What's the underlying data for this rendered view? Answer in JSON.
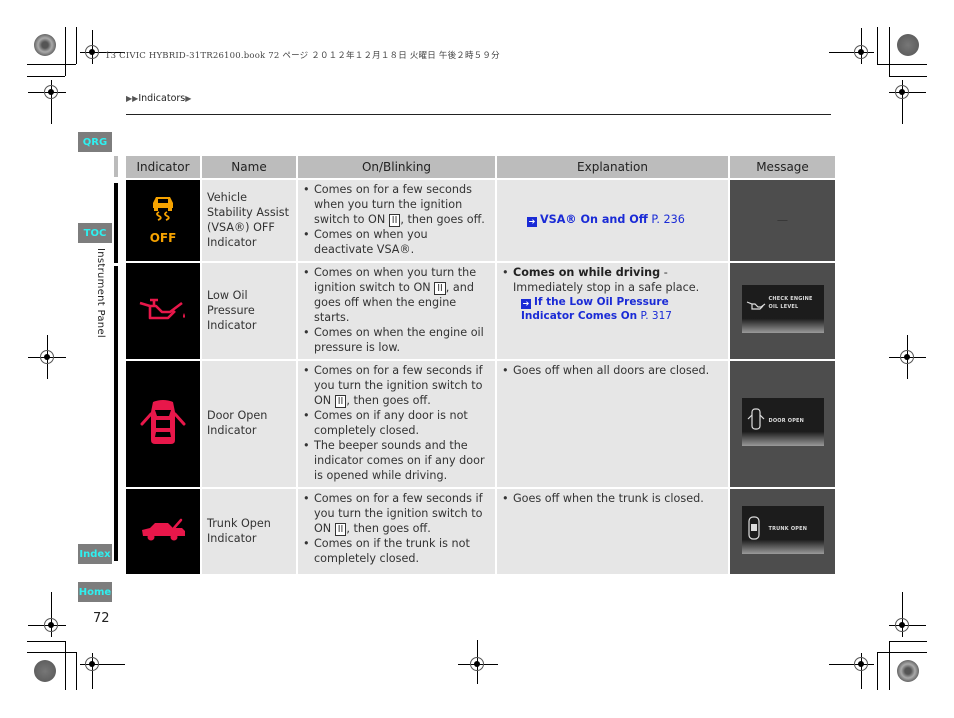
{
  "print_header": "13 CIVIC HYBRID-31TR26100.book  72 ページ  ２０１２年１２月１８日  火曜日  午後２時５９分",
  "breadcrumb": {
    "prefix": "▶▶",
    "label": "Indicators",
    "suffix": "▶"
  },
  "side_nav": {
    "qrg": "QRG",
    "toc": "TOC",
    "section_label": "Instrument Panel",
    "index": "Index",
    "home": "Home"
  },
  "page_number": "72",
  "table": {
    "headers": [
      "Indicator",
      "Name",
      "On/Blinking",
      "Explanation",
      "Message"
    ],
    "key_label": "II",
    "rows": [
      {
        "icon": "vsa-off-icon",
        "icon_color": "#f5a200",
        "icon_text": "OFF",
        "name": "Vehicle Stability Assist (VSA®) OFF Indicator",
        "on_blinking": [
          {
            "pre": "Comes on for a few seconds when you turn the ignition switch to ON ",
            "key": true,
            "post": ", then goes off."
          },
          {
            "pre": "Comes on when you deactivate VSA®.",
            "key": false,
            "post": ""
          }
        ],
        "explanation": {
          "link_bold": "VSA® On and Off",
          "link_page": "P. 236"
        },
        "message": "—"
      },
      {
        "icon": "oil-pressure-icon",
        "icon_color": "#e8174a",
        "name": "Low Oil Pressure Indicator",
        "on_blinking": [
          {
            "pre": "Comes on when you turn the ignition switch to ON ",
            "key": true,
            "post": ", and goes off when the engine starts."
          },
          {
            "pre": "Comes on when the engine oil pressure is low.",
            "key": false,
            "post": ""
          }
        ],
        "explanation": {
          "bullet_bold": "Comes on while driving",
          "bullet_text": " - Immediately stop in a safe place.",
          "link_bold": "If the Low Oil Pressure Indicator Comes On",
          "link_page": "P. 317"
        },
        "message_screen": "CHECK ENGINE OIL LEVEL"
      },
      {
        "icon": "door-open-icon",
        "icon_color": "#e8174a",
        "name": "Door Open Indicator",
        "on_blinking": [
          {
            "pre": "Comes on for a few seconds if you turn the ignition switch to ON ",
            "key": true,
            "post": ", then goes off."
          },
          {
            "pre": "Comes on if any door is not completely closed.",
            "key": false,
            "post": ""
          },
          {
            "pre": "The beeper sounds and the indicator comes on if any door is opened while driving.",
            "key": false,
            "post": ""
          }
        ],
        "explanation": {
          "bullet_text": "Goes off when all doors are closed."
        },
        "message_screen": "DOOR OPEN"
      },
      {
        "icon": "trunk-open-icon",
        "icon_color": "#e8174a",
        "name": "Trunk Open Indicator",
        "on_blinking": [
          {
            "pre": "Comes on for a few seconds if you turn the ignition switch to ON ",
            "key": true,
            "post": ", then goes off."
          },
          {
            "pre": "Comes on if the trunk is not completely closed.",
            "key": false,
            "post": ""
          }
        ],
        "explanation": {
          "bullet_text": "Goes off when the trunk is closed."
        },
        "message_screen": "TRUNK OPEN"
      }
    ]
  }
}
